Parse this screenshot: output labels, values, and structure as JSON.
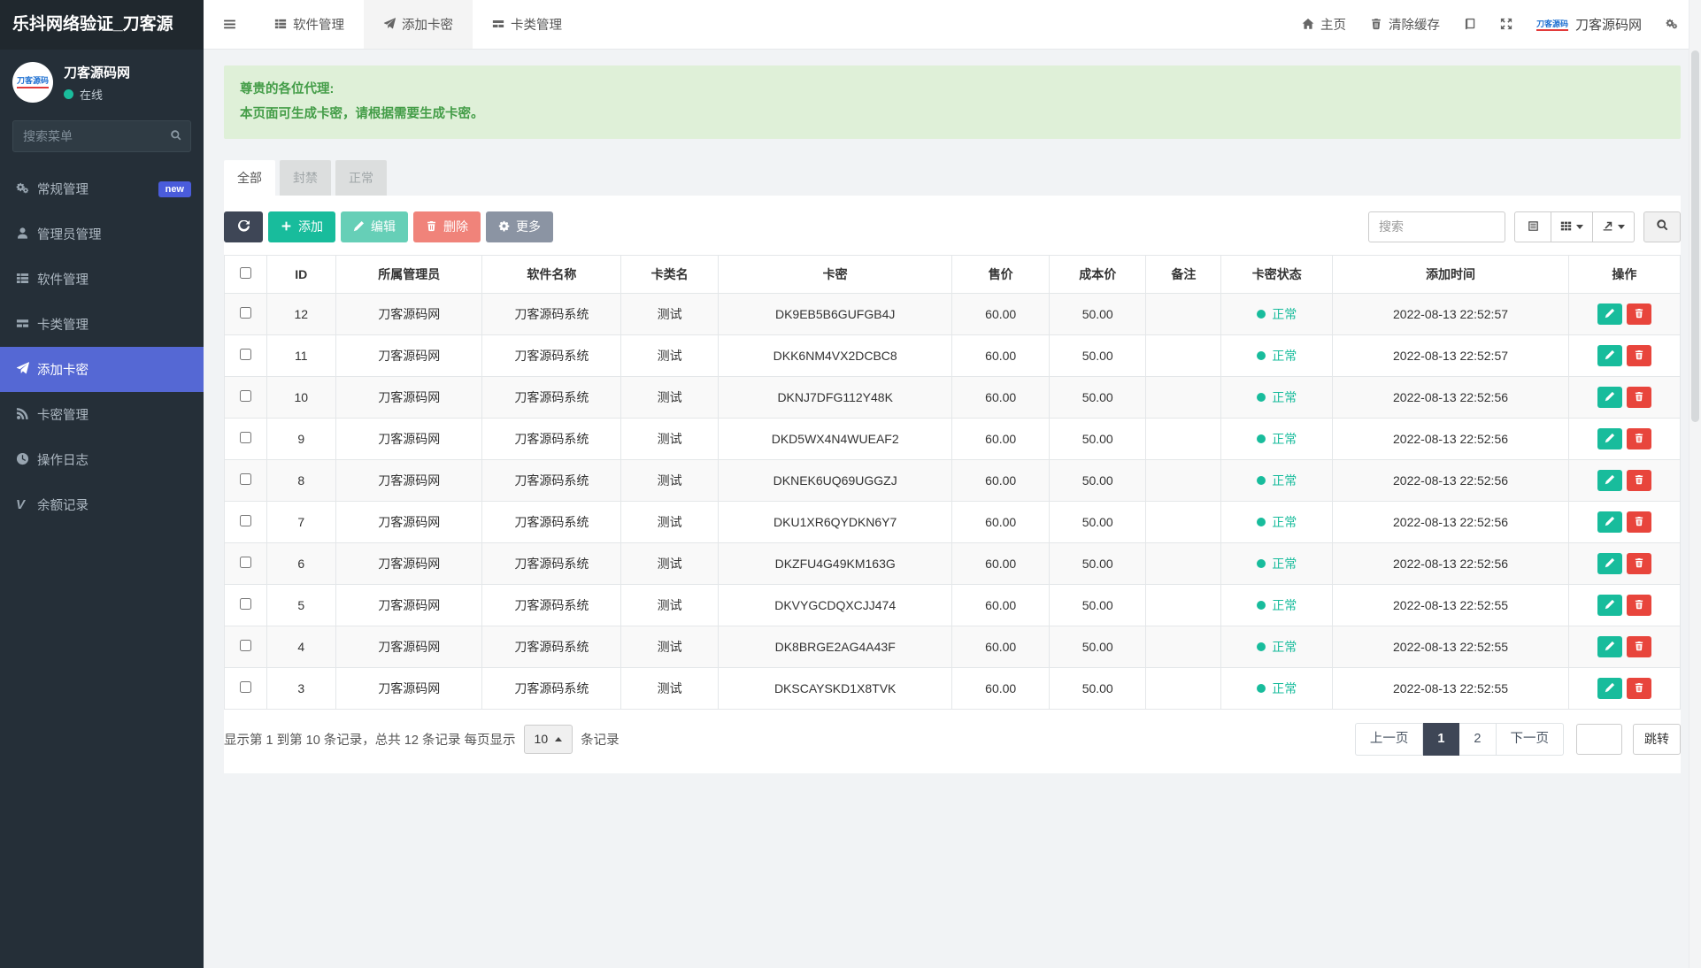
{
  "app": {
    "brand": "乐抖网络验证_刀客源",
    "user": {
      "name": "刀客源码网",
      "status": "在线",
      "avatar_text": "刀客源码"
    },
    "menu_search_placeholder": "搜索菜单"
  },
  "colors": {
    "accent_green": "#18bc9c",
    "danger_red": "#e8453c",
    "active_menu_blue": "#5568d4",
    "alert_green_bg": "#dff0d8",
    "alert_green_text": "#449d48",
    "dark_navy": "#3e4656"
  },
  "sidebar": {
    "items": [
      {
        "key": "general",
        "label": "常规管理",
        "icon": "cogs-icon",
        "badge": "new"
      },
      {
        "key": "admins",
        "label": "管理员管理",
        "icon": "user-icon"
      },
      {
        "key": "software",
        "label": "软件管理",
        "icon": "th-list-icon"
      },
      {
        "key": "card-types",
        "label": "卡类管理",
        "icon": "bars-icon"
      },
      {
        "key": "add-cards",
        "label": "添加卡密",
        "icon": "paper-plane-icon",
        "active": true
      },
      {
        "key": "card-keys",
        "label": "卡密管理",
        "icon": "rss-icon"
      },
      {
        "key": "logs",
        "label": "操作日志",
        "icon": "clock-icon"
      },
      {
        "key": "balance",
        "label": "余额记录",
        "icon": "v-icon"
      }
    ]
  },
  "topnav": {
    "tabs": [
      {
        "key": "software",
        "label": "软件管理",
        "icon": "th-list-icon"
      },
      {
        "key": "add-cards",
        "label": "添加卡密",
        "icon": "paper-plane-icon",
        "active": true
      },
      {
        "key": "card-types",
        "label": "卡类管理",
        "icon": "bars-icon"
      }
    ],
    "right": {
      "home": "主页",
      "clear_cache": "清除缓存",
      "site_name": "刀客源码网",
      "logo_text": "刀客源码"
    }
  },
  "alert": {
    "line1": "尊贵的各位代理:",
    "line2": "本页面可生成卡密，请根据需要生成卡密。"
  },
  "filter_tabs": [
    {
      "key": "all",
      "label": "全部",
      "active": true
    },
    {
      "key": "banned",
      "label": "封禁"
    },
    {
      "key": "normal",
      "label": "正常"
    }
  ],
  "toolbar": {
    "add": "添加",
    "edit": "编辑",
    "delete": "删除",
    "more": "更多",
    "search_placeholder": "搜索"
  },
  "table": {
    "columns": [
      "ID",
      "所属管理员",
      "软件名称",
      "卡类名",
      "卡密",
      "售价",
      "成本价",
      "备注",
      "卡密状态",
      "添加时间",
      "操作"
    ],
    "rows": [
      {
        "id": "12",
        "admin": "刀客源码网",
        "software": "刀客源码系统",
        "card_type": "测试",
        "key": "DK9EB5B6GUFGB4J",
        "price": "60.00",
        "cost": "50.00",
        "remark": "",
        "status": "正常",
        "time": "2022-08-13 22:52:57"
      },
      {
        "id": "11",
        "admin": "刀客源码网",
        "software": "刀客源码系统",
        "card_type": "测试",
        "key": "DKK6NM4VX2DCBC8",
        "price": "60.00",
        "cost": "50.00",
        "remark": "",
        "status": "正常",
        "time": "2022-08-13 22:52:57"
      },
      {
        "id": "10",
        "admin": "刀客源码网",
        "software": "刀客源码系统",
        "card_type": "测试",
        "key": "DKNJ7DFG112Y48K",
        "price": "60.00",
        "cost": "50.00",
        "remark": "",
        "status": "正常",
        "time": "2022-08-13 22:52:56"
      },
      {
        "id": "9",
        "admin": "刀客源码网",
        "software": "刀客源码系统",
        "card_type": "测试",
        "key": "DKD5WX4N4WUEAF2",
        "price": "60.00",
        "cost": "50.00",
        "remark": "",
        "status": "正常",
        "time": "2022-08-13 22:52:56"
      },
      {
        "id": "8",
        "admin": "刀客源码网",
        "software": "刀客源码系统",
        "card_type": "测试",
        "key": "DKNEK6UQ69UGGZJ",
        "price": "60.00",
        "cost": "50.00",
        "remark": "",
        "status": "正常",
        "time": "2022-08-13 22:52:56"
      },
      {
        "id": "7",
        "admin": "刀客源码网",
        "software": "刀客源码系统",
        "card_type": "测试",
        "key": "DKU1XR6QYDKN6Y7",
        "price": "60.00",
        "cost": "50.00",
        "remark": "",
        "status": "正常",
        "time": "2022-08-13 22:52:56"
      },
      {
        "id": "6",
        "admin": "刀客源码网",
        "software": "刀客源码系统",
        "card_type": "测试",
        "key": "DKZFU4G49KM163G",
        "price": "60.00",
        "cost": "50.00",
        "remark": "",
        "status": "正常",
        "time": "2022-08-13 22:52:56"
      },
      {
        "id": "5",
        "admin": "刀客源码网",
        "software": "刀客源码系统",
        "card_type": "测试",
        "key": "DKVYGCDQXCJJ474",
        "price": "60.00",
        "cost": "50.00",
        "remark": "",
        "status": "正常",
        "time": "2022-08-13 22:52:55"
      },
      {
        "id": "4",
        "admin": "刀客源码网",
        "software": "刀客源码系统",
        "card_type": "测试",
        "key": "DK8BRGE2AG4A43F",
        "price": "60.00",
        "cost": "50.00",
        "remark": "",
        "status": "正常",
        "time": "2022-08-13 22:52:55"
      },
      {
        "id": "3",
        "admin": "刀客源码网",
        "software": "刀客源码系统",
        "card_type": "测试",
        "key": "DKSCAYSKD1X8TVK",
        "price": "60.00",
        "cost": "50.00",
        "remark": "",
        "status": "正常",
        "time": "2022-08-13 22:52:55"
      }
    ]
  },
  "pagination": {
    "summary_prefix": "显示第 1 到第 10 条记录，总共 12 条记录 每页显示",
    "page_size": "10",
    "summary_suffix": "条记录",
    "prev": "上一页",
    "next": "下一页",
    "pages": [
      "1",
      "2"
    ],
    "active_page": "1",
    "jump": "跳转"
  }
}
